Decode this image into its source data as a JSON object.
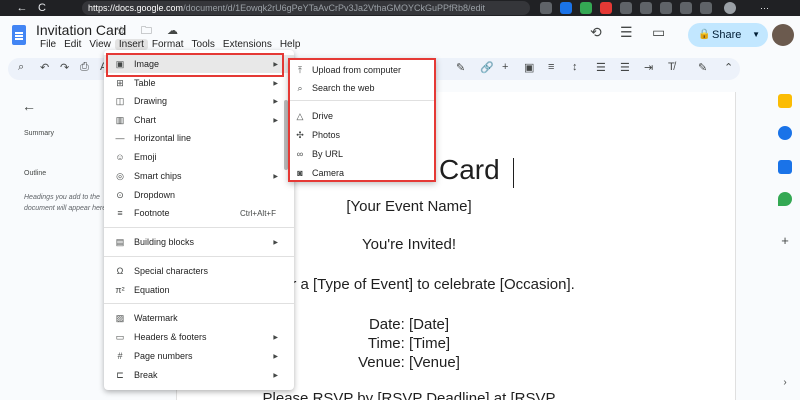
{
  "browser": {
    "back_glyph": "←",
    "reload_glyph": "C",
    "url_host": "https://docs.google.com",
    "url_path": "/document/d/1Eowqk2rU6gPeYTaAvCrPv3Ja2VthaGMOYCkGuPPfRb8/edit"
  },
  "header": {
    "doc_title": "Invitation Card",
    "title_icons": "☆ 🗀 ☁",
    "share_label": "Share",
    "lock_glyph": "🔒",
    "caret_glyph": "▼",
    "history_glyph": "⟲",
    "comment_glyph": "☰",
    "meet_glyph": "▭"
  },
  "menubar": [
    "File",
    "Edit",
    "View",
    "Insert",
    "Format",
    "Tools",
    "Extensions",
    "Help"
  ],
  "toolbar": {
    "search_glyph": "⌕",
    "undo_glyph": "↶",
    "redo_glyph": "↷",
    "print_glyph": "⎙",
    "paint_glyph": "A",
    "link_glyph": "🔗",
    "comment_glyph": "+",
    "image_glyph": "▣",
    "align_glyph": "≡",
    "spacing_glyph": "↕",
    "list_glyph": "☰",
    "indent_glyph": "⇥",
    "clear_glyph": "T̸",
    "edit_glyph": "✎",
    "collapse_glyph": "⌃"
  },
  "outline": {
    "back_glyph": "←",
    "summary": "Summary",
    "outline": "Outline",
    "hint": "Headings you add to the document will appear here."
  },
  "document": {
    "title_visible": "Card",
    "event_name": "[Your Event Name]",
    "invited": "You're Invited!",
    "event_line": "or a [Type of Event] to celebrate [Occasion].",
    "date": "Date: [Date]",
    "time": "Time: [Time]",
    "venue": "Venue: [Venue]",
    "rsvp": "Please RSVP by [RSVP Deadline] at [RSVP"
  },
  "insert_menu": {
    "image": {
      "label": "Image",
      "icon": "▣"
    },
    "table": {
      "label": "Table",
      "icon": "⊞"
    },
    "drawing": {
      "label": "Drawing",
      "icon": "◫"
    },
    "chart": {
      "label": "Chart",
      "icon": "▥"
    },
    "hline": {
      "label": "Horizontal line",
      "icon": "—"
    },
    "emoji": {
      "label": "Emoji",
      "icon": "☺"
    },
    "smartchips": {
      "label": "Smart chips",
      "icon": "◎"
    },
    "dropdown": {
      "label": "Dropdown",
      "icon": "⊙"
    },
    "footnote": {
      "label": "Footnote",
      "icon": "≡",
      "shortcut": "Ctrl+Alt+F"
    },
    "building": {
      "label": "Building blocks",
      "icon": "▤"
    },
    "special": {
      "label": "Special characters",
      "icon": "Ω"
    },
    "equation": {
      "label": "Equation",
      "icon": "π²"
    },
    "watermark": {
      "label": "Watermark",
      "icon": "▨"
    },
    "headers": {
      "label": "Headers & footers",
      "icon": "▭"
    },
    "pagenum": {
      "label": "Page numbers",
      "icon": "#"
    },
    "break": {
      "label": "Break",
      "icon": "⊏"
    },
    "arrow_glyph": "▶"
  },
  "image_submenu": {
    "upload": {
      "label": "Upload from computer",
      "icon": "⤒"
    },
    "search": {
      "label": "Search the web",
      "icon": "⌕"
    },
    "drive": {
      "label": "Drive",
      "icon": "△"
    },
    "photos": {
      "label": "Photos",
      "icon": "✣"
    },
    "byurl": {
      "label": "By URL",
      "icon": "∞"
    },
    "camera": {
      "label": "Camera",
      "icon": "◙"
    }
  },
  "colors": {
    "highlight_box": "#e53935",
    "share_bg": "#c2e7ff",
    "docs_blue": "#4285f4"
  }
}
